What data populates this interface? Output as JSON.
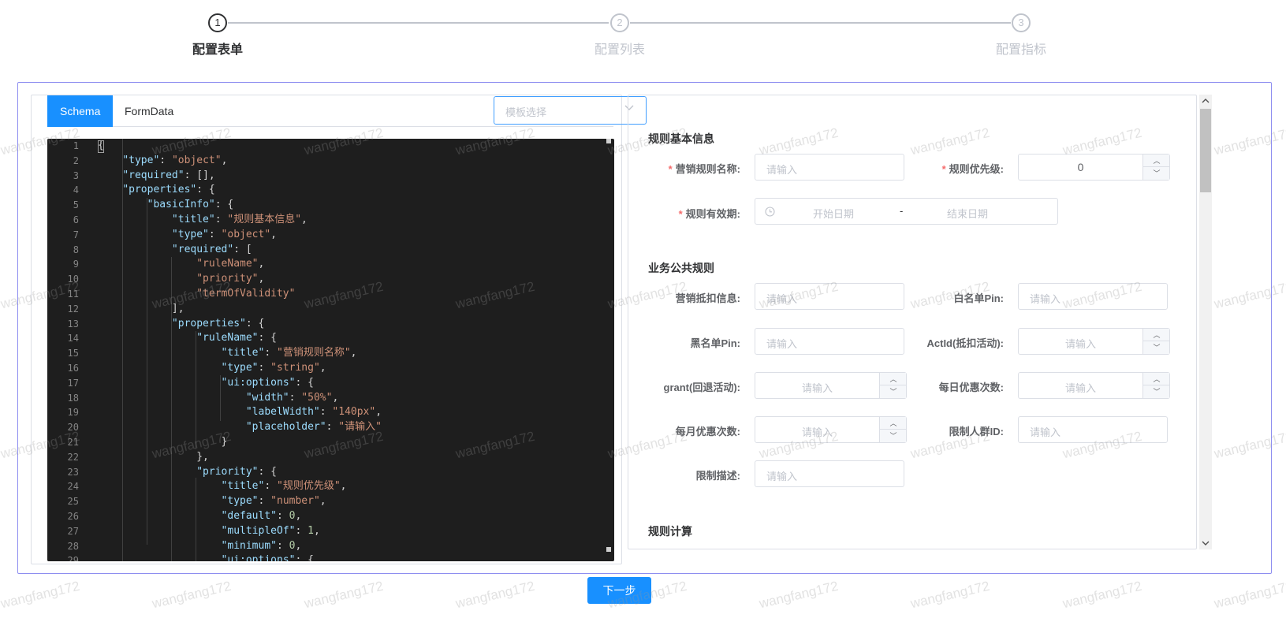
{
  "steps": [
    {
      "num": "1",
      "title": "配置表单"
    },
    {
      "num": "2",
      "title": "配置列表"
    },
    {
      "num": "3",
      "title": "配置指标"
    }
  ],
  "active_step": 1,
  "left": {
    "tabs": [
      {
        "label": "Schema"
      },
      {
        "label": "FormData"
      }
    ],
    "template_select": {
      "placeholder": "模板选择"
    }
  },
  "editor": {
    "line_numbers": [
      "1",
      "2",
      "3",
      "4",
      "5",
      "6",
      "7",
      "8",
      "9",
      "10",
      "11",
      "12",
      "13",
      "14",
      "15",
      "16",
      "17",
      "18",
      "19",
      "20",
      "21",
      "22",
      "23",
      "24",
      "25",
      "26",
      "27",
      "28",
      "29"
    ],
    "lines": [
      "{",
      "    \"type\": \"object\",",
      "    \"required\": [],",
      "    \"properties\": {",
      "        \"basicInfo\": {",
      "            \"title\": \"规则基本信息\",",
      "            \"type\": \"object\",",
      "            \"required\": [",
      "                \"ruleName\",",
      "                \"priority\",",
      "                \"termOfValidity\"",
      "            ],",
      "            \"properties\": {",
      "                \"ruleName\": {",
      "                    \"title\": \"营销规则名称\",",
      "                    \"type\": \"string\",",
      "                    \"ui:options\": {",
      "                        \"width\": \"50%\",",
      "                        \"labelWidth\": \"140px\",",
      "                        \"placeholder\": \"请输入\"",
      "                    }",
      "                },",
      "                \"priority\": {",
      "                    \"title\": \"规则优先级\",",
      "                    \"type\": \"number\",",
      "                    \"default\": 0,",
      "                    \"multipleOf\": 1,",
      "                    \"minimum\": 0,",
      "                    \"ui:options\": {"
    ]
  },
  "form": {
    "section1": {
      "title": "规则基本信息",
      "rule_name_label": "营销规则名称:",
      "rule_name_placeholder": "请输入",
      "priority_label": "规则优先级:",
      "priority_value": "0",
      "validity_label": "规则有效期:",
      "start_placeholder": "开始日期",
      "range_sep": "-",
      "end_placeholder": "结束日期",
      "required_mark": "*"
    },
    "section2": {
      "title": "业务公共规则",
      "fields": [
        {
          "label": "营销抵扣信息:",
          "placeholder": "请输入"
        },
        {
          "label": "白名单Pin:",
          "placeholder": "请输入"
        },
        {
          "label": "黑名单Pin:",
          "placeholder": "请输入"
        },
        {
          "label": "ActId(抵扣活动):",
          "placeholder": "请输入"
        },
        {
          "label": "grant(回退活动):",
          "placeholder": "请输入"
        },
        {
          "label": "每日优惠次数:",
          "placeholder": "请输入"
        },
        {
          "label": "每月优惠次数:",
          "placeholder": "请输入"
        },
        {
          "label": "限制人群ID:",
          "placeholder": "请输入"
        },
        {
          "label": "限制描述:",
          "placeholder": "请输入"
        }
      ]
    },
    "section3": {
      "title": "规则计算"
    }
  },
  "next_button": "下一步",
  "watermark": "wangfang172",
  "colors": {
    "primary": "#1890ff",
    "border_accent": "#8e8ef0",
    "editor_bg": "#1e1e1e",
    "required": "#f56c6c"
  }
}
